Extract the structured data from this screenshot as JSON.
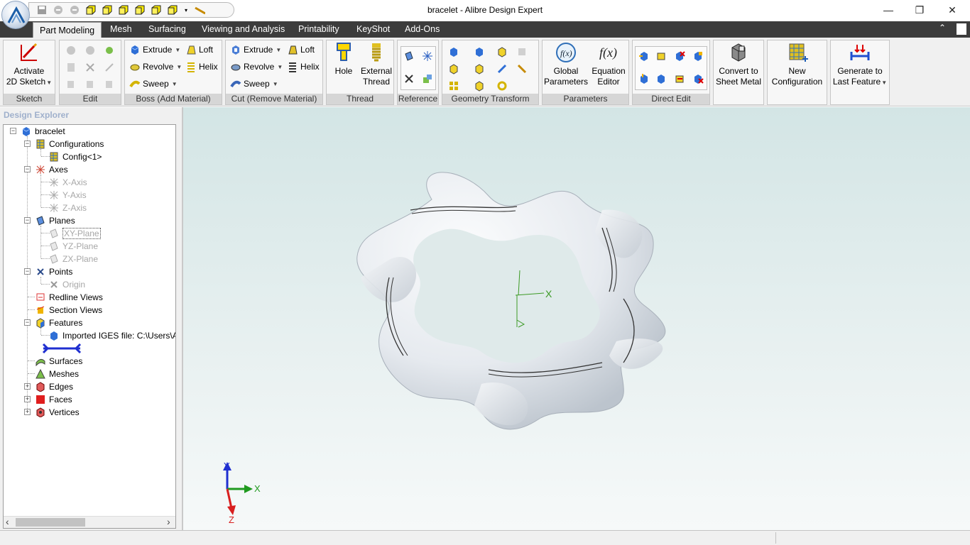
{
  "window": {
    "title": "bracelet - Alibre Design Expert",
    "minimize": "—",
    "restore": "❐",
    "close": "✕"
  },
  "ribbon_tabs": [
    {
      "label": "Part Modeling",
      "active": true
    },
    {
      "label": "Mesh"
    },
    {
      "label": "Surfacing"
    },
    {
      "label": "Viewing and Analysis"
    },
    {
      "label": "Printability"
    },
    {
      "label": "KeyShot"
    },
    {
      "label": "Add-Ons"
    }
  ],
  "ribbon": {
    "collapse_glyph": "⌃",
    "sketch": {
      "group": "Sketch",
      "activate_line1": "Activate",
      "activate_line2": "2D Sketch"
    },
    "edit": {
      "group": "Edit"
    },
    "boss": {
      "group": "Boss (Add Material)",
      "extrude": "Extrude",
      "revolve": "Revolve",
      "sweep": "Sweep",
      "loft": "Loft",
      "helix": "Helix"
    },
    "cut": {
      "group": "Cut (Remove Material)",
      "extrude": "Extrude",
      "revolve": "Revolve",
      "sweep": "Sweep",
      "loft": "Loft",
      "helix": "Helix"
    },
    "thread": {
      "group": "Thread",
      "hole": "Hole",
      "external_line1": "External",
      "external_line2": "Thread"
    },
    "reference": {
      "group": "Reference"
    },
    "geometry": {
      "group": "Geometry Transform"
    },
    "parameters": {
      "group": "Parameters",
      "global_line1": "Global",
      "global_line2": "Parameters",
      "equation_line1": "Equation",
      "equation_line2": "Editor"
    },
    "direct": {
      "group": "Direct Edit"
    },
    "sheet": {
      "line1": "Convert to",
      "line2": "Sheet Metal"
    },
    "config": {
      "line1": "New",
      "line2": "Configuration"
    },
    "generate": {
      "line1": "Generate to",
      "line2": "Last Feature"
    }
  },
  "explorer": {
    "title": "Design Explorer",
    "root": "bracelet",
    "configurations": "Configurations",
    "config1": "Config<1>",
    "axes": "Axes",
    "x_axis": "X-Axis",
    "y_axis": "Y-Axis",
    "z_axis": "Z-Axis",
    "planes": "Planes",
    "xy_plane": "XY-Plane",
    "yz_plane": "YZ-Plane",
    "zx_plane": "ZX-Plane",
    "points": "Points",
    "origin": "Origin",
    "redline": "Redline Views",
    "section": "Section Views",
    "features": "Features",
    "imported": "Imported IGES file: C:\\Users\\ASh",
    "surfaces": "Surfaces",
    "meshes": "Meshes",
    "edges": "Edges",
    "faces": "Faces",
    "vertices": "Vertices",
    "scroll_left": "‹",
    "scroll_right": "›"
  },
  "viewport": {
    "triad": {
      "x": "X",
      "y": "Y",
      "z": "Z"
    },
    "origin_axis_label": "X",
    "colors": {
      "x_axis": "#1f9a1f",
      "y_axis": "#1f2fd0",
      "z_axis": "#d81f1f",
      "origin": "#3c9a25"
    }
  },
  "colors": {
    "tab_bar": "#3c3c3c",
    "ribbon_bg": "#f0f0f0",
    "group_label_bg": "#d6d6d6",
    "accent": "#1f5fb8"
  }
}
